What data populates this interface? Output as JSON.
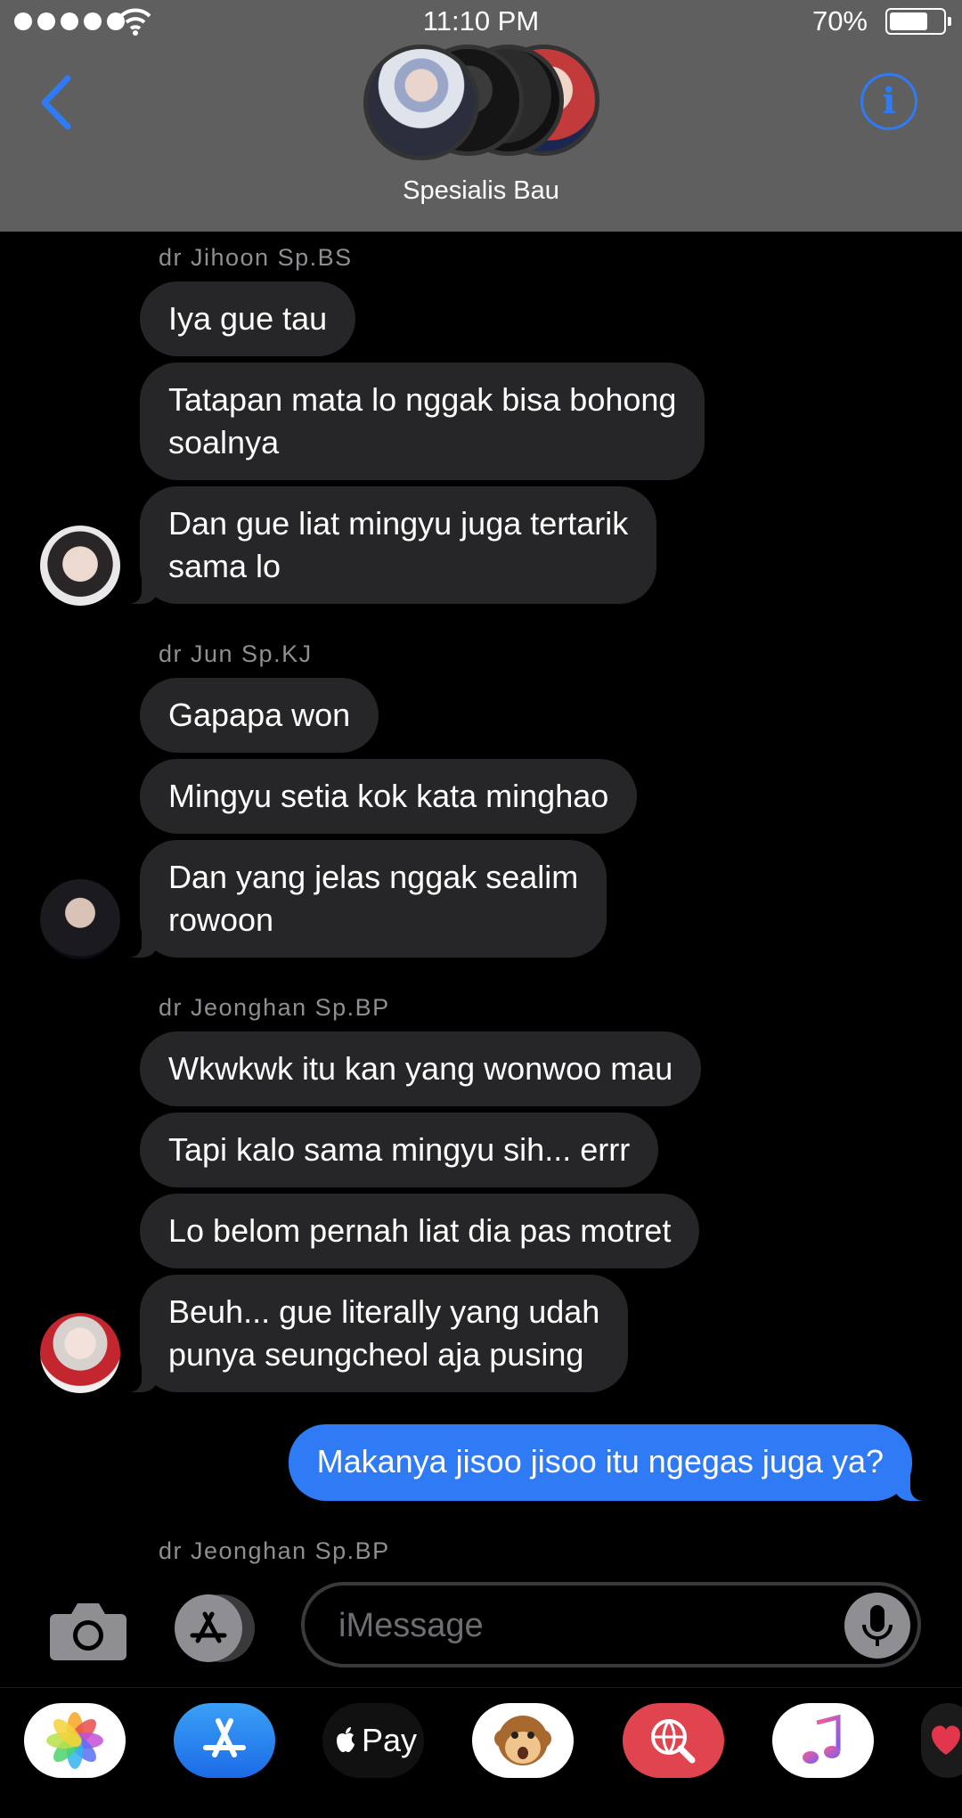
{
  "status_bar": {
    "time": "11:10 PM",
    "battery": "70%"
  },
  "header": {
    "group_name": "Spesialis Bau"
  },
  "messages": {
    "group1": {
      "sender": "dr Jihoon Sp.BS",
      "b1": "Iya gue tau",
      "b2_l1": "Tatapan mata lo nggak bisa bohong",
      "b2_l2": "soalnya",
      "b3_l1": "Dan gue liat mingyu juga tertarik",
      "b3_l2": "sama lo"
    },
    "group2": {
      "sender": "dr Jun Sp.KJ",
      "b1": "Gapapa won",
      "b2": "Mingyu setia kok kata minghao",
      "b3_l1": "Dan yang jelas nggak sealim",
      "b3_l2": "rowoon"
    },
    "group3": {
      "sender": "dr Jeonghan Sp.BP",
      "b1": "Wkwkwk itu kan yang wonwoo mau",
      "b2": "Tapi kalo sama mingyu sih... errr",
      "b3": "Lo belom pernah liat dia pas motret",
      "b4_l1": "Beuh... gue literally yang udah",
      "b4_l2": "punya seungcheol aja pusing"
    },
    "outgoing": "Makanya jisoo jisoo itu ngegas juga ya?",
    "group4": {
      "sender": "dr Jeonghan Sp.BP"
    }
  },
  "input": {
    "placeholder": "iMessage"
  },
  "app_drawer": {
    "applepay_label": " Pay"
  },
  "colors": {
    "accent": "#2f7bf5",
    "incoming_bubble": "#262628",
    "header_bg": "#5f5f5f"
  }
}
